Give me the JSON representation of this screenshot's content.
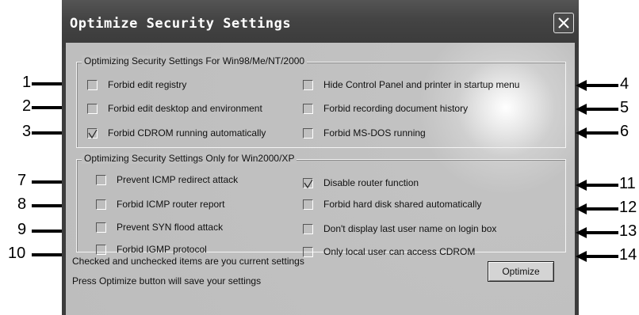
{
  "window": {
    "title": "Optimize Security Settings"
  },
  "group1": {
    "legend": "Optimizing Security Settings For Win98/Me/NT/2000",
    "items": [
      {
        "label": "Forbid edit registry",
        "checked": false
      },
      {
        "label": "Forbid edit desktop and environment",
        "checked": false
      },
      {
        "label": "Forbid CDROM running automatically",
        "checked": true
      },
      {
        "label": "Hide Control Panel and printer in startup menu",
        "checked": false
      },
      {
        "label": "Forbid recording document history",
        "checked": false
      },
      {
        "label": "Forbid MS-DOS running",
        "checked": false
      }
    ]
  },
  "group2": {
    "legend": "Optimizing Security Settings Only for Win2000/XP",
    "items": [
      {
        "label": "Prevent ICMP redirect attack",
        "checked": false
      },
      {
        "label": "Forbid ICMP router report",
        "checked": false
      },
      {
        "label": "Prevent SYN flood attack",
        "checked": false
      },
      {
        "label": "Forbid IGMP protocol",
        "checked": false
      },
      {
        "label": "Disable router function",
        "checked": true
      },
      {
        "label": "Forbid hard disk shared automatically",
        "checked": false
      },
      {
        "label": "Don't display last user name on login box",
        "checked": false
      },
      {
        "label": "Only local user can access CDROM",
        "checked": false
      }
    ]
  },
  "footer": {
    "line1": "Checked and unchecked items are you current settings",
    "line2": "Press Optimize button will save your settings",
    "optimize_label": "Optimize"
  },
  "callouts": {
    "left": [
      "1",
      "2",
      "3",
      "7",
      "8",
      "9",
      "10"
    ],
    "right": [
      "4",
      "5",
      "6",
      "11",
      "12",
      "13",
      "14"
    ]
  }
}
